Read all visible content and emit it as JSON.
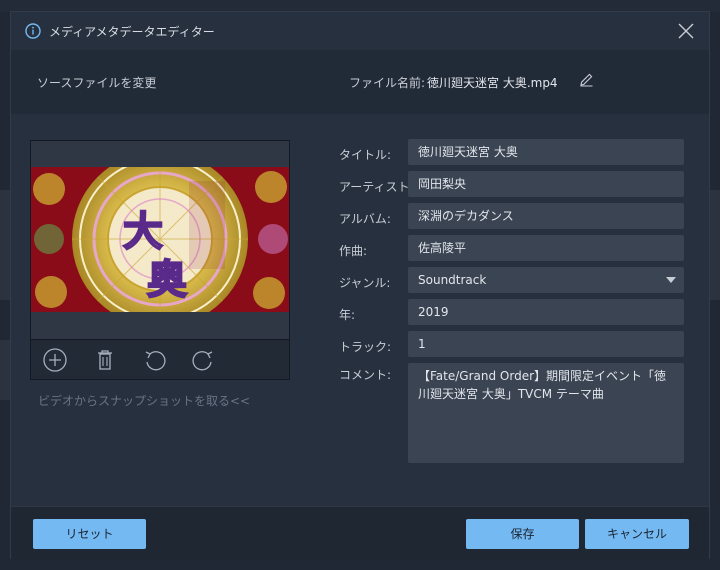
{
  "dialog": {
    "title": "メディアメタデータエディター",
    "source_change": "ソースファイルを変更",
    "file_label": "ファイル名前:",
    "file_name": "徳川廻天迷宮 大奥.mp4"
  },
  "preview": {
    "snapshot_link": "ビデオからスナップショットを取る<<",
    "tools": [
      "add-icon",
      "trash-icon",
      "rotate-left-icon",
      "rotate-right-icon"
    ]
  },
  "fields": {
    "title": {
      "label": "タイトル:",
      "value": "徳川廻天迷宮 大奥"
    },
    "artist": {
      "label": "アーティスト:",
      "value": "岡田梨央"
    },
    "album": {
      "label": "アルバム:",
      "value": "深淵のデカダンス"
    },
    "composer": {
      "label": "作曲:",
      "value": "佐高陵平"
    },
    "genre": {
      "label": "ジャンル:",
      "value": "Soundtrack"
    },
    "year": {
      "label": "年:",
      "value": "2019"
    },
    "track": {
      "label": "トラック:",
      "value": "1"
    },
    "comment": {
      "label": "コメント:",
      "value": "【Fate/Grand Order】期間限定イベント「徳川廻天迷宮 大奥」TVCM テーマ曲"
    }
  },
  "footer": {
    "reset": "リセット",
    "save": "保存",
    "cancel": "キャンセル"
  },
  "colors": {
    "accent": "#74b9f2",
    "dialog_bg": "#27303e",
    "field_bg": "#3b4452"
  }
}
